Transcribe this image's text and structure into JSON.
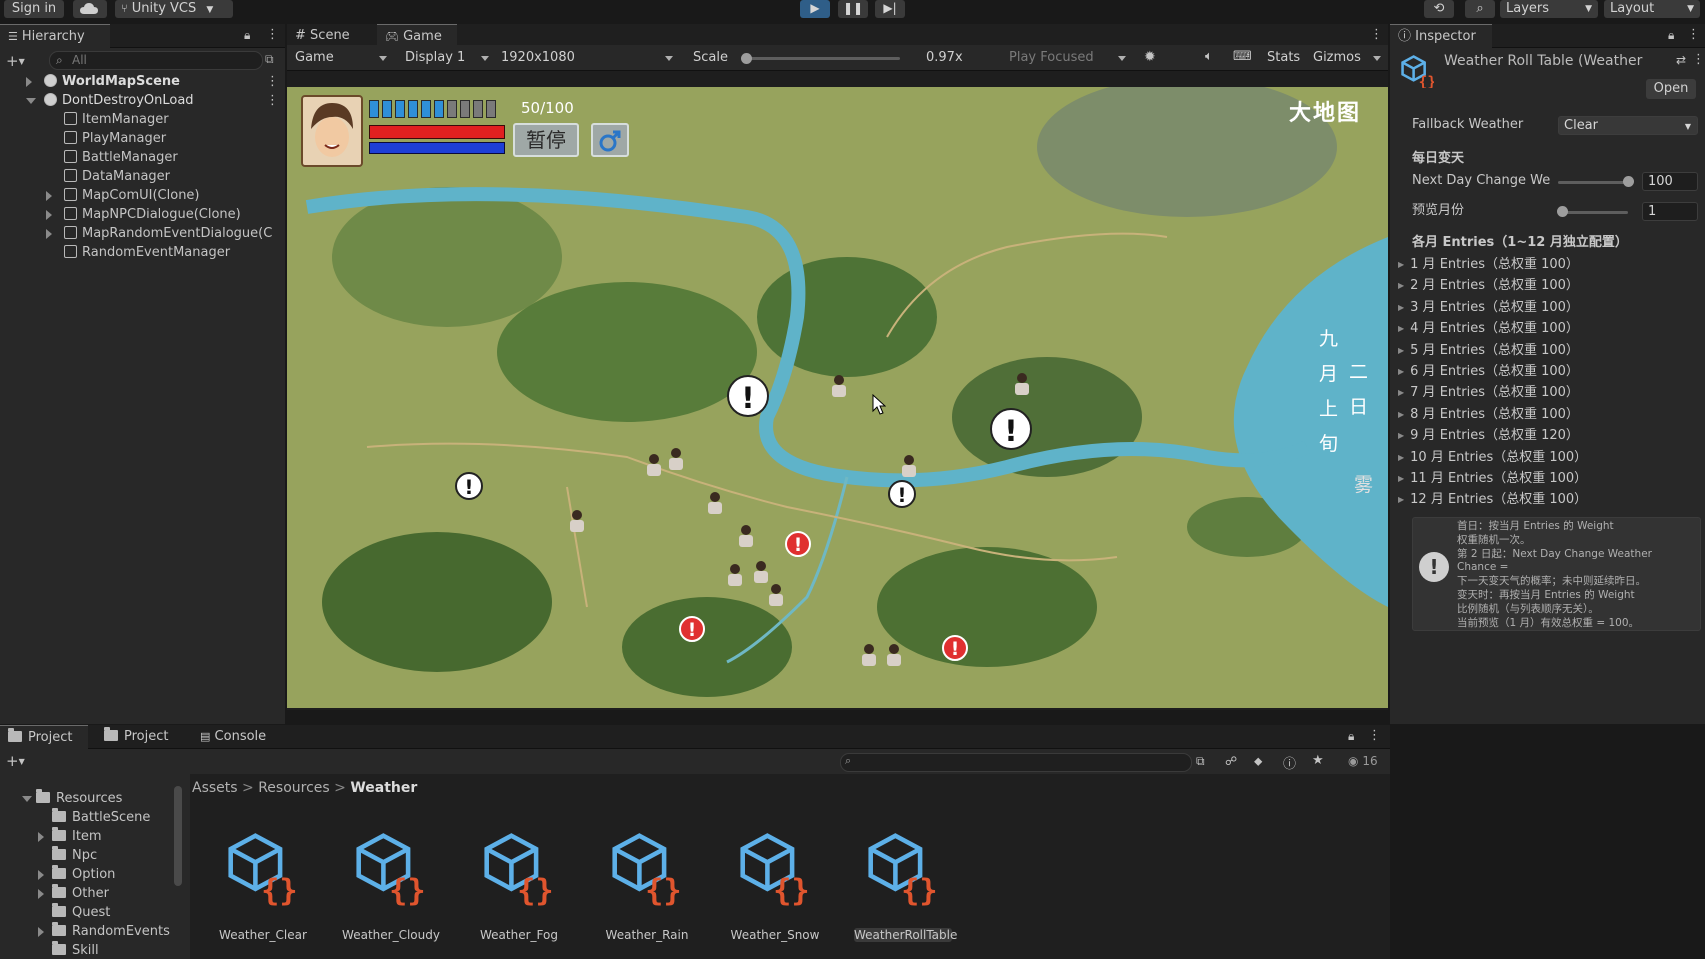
{
  "toolbar": {
    "sign_in": "Sign in",
    "vcs": "Unity VCS",
    "layers": "Layers",
    "layout": "Layout"
  },
  "hierarchy": {
    "tab": "Hierarchy",
    "search_placeholder": "All",
    "items": [
      {
        "label": "WorldMapScene",
        "bold": true
      },
      {
        "label": "DontDestroyOnLoad",
        "bold": false
      },
      {
        "label": "ItemManager"
      },
      {
        "label": "PlayManager"
      },
      {
        "label": "BattleManager"
      },
      {
        "label": "DataManager"
      },
      {
        "label": "MapComUI(Clone)"
      },
      {
        "label": "MapNPCDialogue(Clone)"
      },
      {
        "label": "MapRandomEventDialogue(C"
      },
      {
        "label": "RandomEventManager"
      }
    ]
  },
  "view_tabs": {
    "scene": "Scene",
    "game": "Game"
  },
  "gamebar": {
    "mode": "Game",
    "display": "Display 1",
    "resolution": "1920x1080",
    "scale_label": "Scale",
    "scale_value": "0.97x",
    "play_focused": "Play Focused",
    "stats": "Stats",
    "gizmos": "Gizmos"
  },
  "game_hud": {
    "hp_text": "50/100",
    "pause_btn": "暂停",
    "map_title": "大地图",
    "date_col1": "九月上旬",
    "date_col2": "二日",
    "weather": "雾"
  },
  "inspector": {
    "tab": "Inspector",
    "object_title": "Weather Roll Table (Weather",
    "open_btn": "Open",
    "fallback_label": "Fallback Weather",
    "fallback_value": "Clear",
    "daily_header": "每日变天",
    "next_day_label": "Next Day Change We",
    "next_day_value": "100",
    "next_day_fraction": 1.0,
    "preview_month_label": "预览月份",
    "preview_month_value": "1",
    "preview_month_fraction": 0.0,
    "monthly_header": "各月 Entries（1~12 月独立配置）",
    "months": [
      "1 月  Entries（总权重 100）",
      "2 月  Entries（总权重 100）",
      "3 月  Entries（总权重 100）",
      "4 月  Entries（总权重 100）",
      "5 月  Entries（总权重 100）",
      "6 月  Entries（总权重 100）",
      "7 月  Entries（总权重 100）",
      "8 月  Entries（总权重 100）",
      "9 月  Entries（总权重 120）",
      "10 月  Entries（总权重 100）",
      "11 月  Entries（总权重 100）",
      "12 月  Entries（总权重 100）"
    ],
    "help_lines": [
      "首日：按当月 Entries 的 Weight",
      "权重随机一次。",
      "第 2 日起：Next Day Change Weather",
      "Chance =",
      "下一天变天气的概率；未中则延续昨日。",
      "变天时：再按当月 Entries 的 Weight",
      "比例随机（与列表顺序无关）。",
      "当前预览（1 月）有效总权重 = 100。"
    ]
  },
  "bottom": {
    "tab_project1": "Project",
    "tab_project2": "Project",
    "tab_console": "Console",
    "count": "16",
    "breadcrumb": [
      "Assets",
      "Resources",
      "Weather"
    ],
    "folders": [
      {
        "label": "Resources",
        "indent": 0
      },
      {
        "label": "BattleScene",
        "indent": 1
      },
      {
        "label": "Item",
        "indent": 1
      },
      {
        "label": "Npc",
        "indent": 1
      },
      {
        "label": "Option",
        "indent": 1
      },
      {
        "label": "Other",
        "indent": 1
      },
      {
        "label": "Quest",
        "indent": 1
      },
      {
        "label": "RandomEvents",
        "indent": 1
      },
      {
        "label": "Skill",
        "indent": 1
      }
    ],
    "assets": [
      "Weather_Clear",
      "Weather_Cloudy",
      "Weather_Fog",
      "Weather_Rain",
      "Weather_Snow",
      "WeatherRollTable"
    ]
  },
  "colors": {
    "accent": "#2c5d87",
    "hp": "#e02020",
    "mp": "#1d3fd6",
    "water": "#5fb3c9"
  }
}
